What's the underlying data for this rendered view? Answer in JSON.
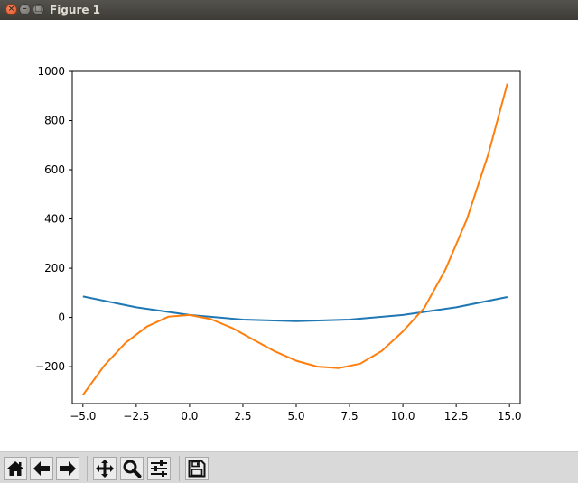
{
  "window": {
    "title": "Figure 1"
  },
  "toolbar": {
    "buttons": [
      {
        "name": "home-icon",
        "tooltip": "Home"
      },
      {
        "name": "back-arrow-icon",
        "tooltip": "Back"
      },
      {
        "name": "forward-arrow-icon",
        "tooltip": "Forward"
      },
      {
        "name": "pan-move-icon",
        "tooltip": "Pan"
      },
      {
        "name": "zoom-magnifier-icon",
        "tooltip": "Zoom"
      },
      {
        "name": "configure-subplots-icon",
        "tooltip": "Configure subplots"
      },
      {
        "name": "save-floppy-icon",
        "tooltip": "Save"
      }
    ]
  },
  "chart_data": {
    "type": "line",
    "title": "",
    "xlabel": "",
    "ylabel": "",
    "xlim": [
      -5.5,
      15.5
    ],
    "ylim": [
      -350,
      1000
    ],
    "grid": false,
    "legend": "none",
    "xticks": [
      -5.0,
      -2.5,
      0.0,
      2.5,
      5.0,
      7.5,
      10.0,
      12.5,
      15.0
    ],
    "xtick_labels": [
      "−5.0",
      "−2.5",
      "0.0",
      "2.5",
      "5.0",
      "7.5",
      "10.0",
      "12.5",
      "15.0"
    ],
    "yticks": [
      -200,
      0,
      200,
      400,
      600,
      800,
      1000
    ],
    "ytick_labels": [
      "−200",
      "0",
      "200",
      "400",
      "600",
      "800",
      "1000"
    ],
    "series": [
      {
        "color": "#1f77b4",
        "x": [
          -5.0,
          -2.5,
          0.0,
          2.5,
          5.0,
          7.5,
          10.0,
          12.5,
          14.9
        ],
        "y": [
          85,
          41,
          10,
          -9,
          -15,
          -9,
          10,
          41,
          83
        ]
      },
      {
        "color": "#ff7f0e",
        "x": [
          -5.0,
          -4.0,
          -3.0,
          -2.0,
          -1.0,
          0.0,
          1.0,
          2.0,
          3.0,
          4.0,
          5.0,
          6.0,
          7.0,
          8.0,
          9.0,
          10.0,
          11.0,
          12.0,
          13.0,
          14.0,
          14.9
        ],
        "y": [
          -315,
          -196,
          -103,
          -37,
          3,
          10,
          -7,
          -43,
          -91,
          -138,
          -176,
          -200,
          -206,
          -188,
          -137,
          -57,
          38,
          195,
          399,
          662,
          950
        ]
      }
    ]
  }
}
